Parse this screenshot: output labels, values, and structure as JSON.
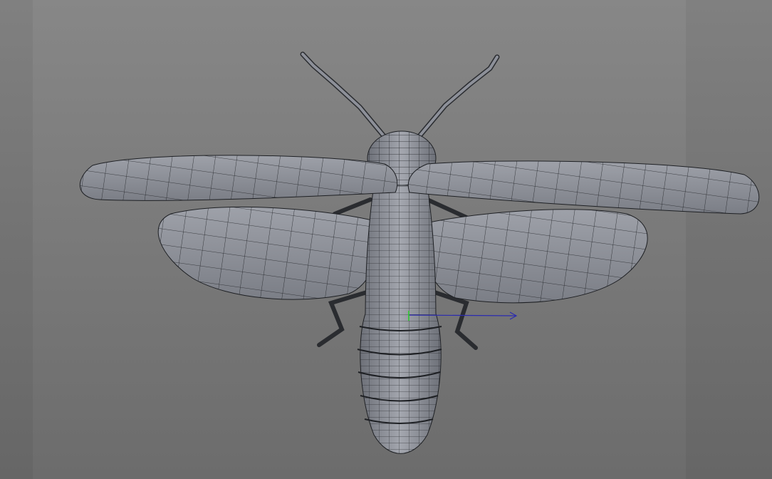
{
  "viewport": {
    "model": "firefly",
    "colors": {
      "background_top": "#878787",
      "background_bottom": "#6c6c6c",
      "mesh_fill": "#8d9099",
      "mesh_light": "#a7aab2",
      "wire": "#1e2024",
      "axis_x": "#2b2bb0",
      "axis_y": "#22cc22"
    }
  }
}
